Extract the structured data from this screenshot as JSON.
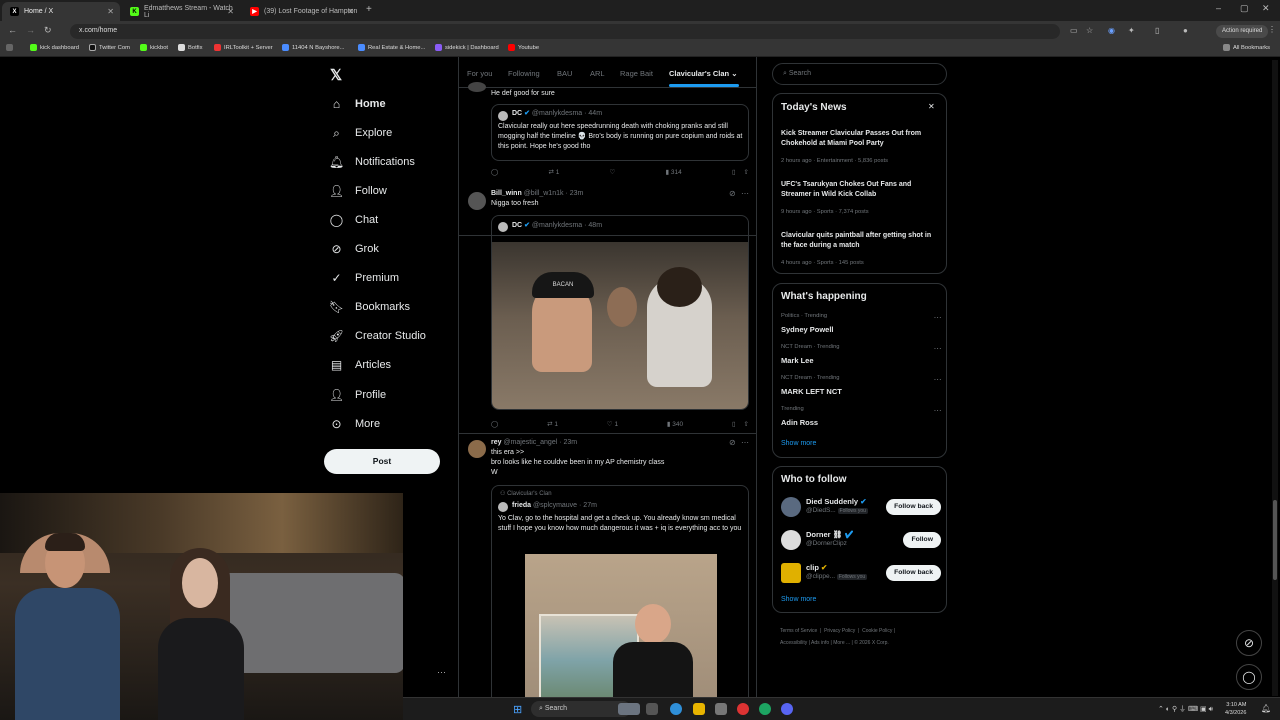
{
  "browser": {
    "tabs": [
      {
        "title": "Home / X",
        "active": true
      },
      {
        "title": "Edmatthews Stream - Watch Li",
        "active": false
      },
      {
        "title": "(39) Lost Footage of Hampton",
        "active": false
      }
    ],
    "url": "x.com/home",
    "action_label": "Action required",
    "bookmarks": [
      "kick dashboard",
      "Twitter Com",
      "kickbot",
      "Botfix",
      "IRLToolkit + Server",
      "11404 N Bayshore...",
      "Real Estate & Home...",
      "sidekick | Dashboard",
      "Youtube"
    ],
    "all_bookmarks": "All Bookmarks"
  },
  "nav": {
    "items": [
      "Home",
      "Explore",
      "Notifications",
      "Follow",
      "Chat",
      "Grok",
      "Premium",
      "Bookmarks",
      "Creator Studio",
      "Articles",
      "Profile",
      "More"
    ],
    "post_label": "Post"
  },
  "timeline": {
    "tabs": [
      "For you",
      "Following",
      "BAU",
      "ARL",
      "Rage Bait",
      "Clavicular's Clan"
    ],
    "post1": {
      "text": "He def good for sure",
      "quote_name": "DC",
      "quote_handle": "@manlykdesma · 44m",
      "quote_text": "Clavicular really out here speedrunning death with choking pranks and still mogging half the timeline 💀 Bro's body is running on pure copium and roids at this point. Hope he's good tho",
      "stats": [
        "",
        "1",
        "",
        "314",
        "",
        ""
      ]
    },
    "post2": {
      "name": "Bill_winn",
      "handle": "@bill_w1n1k · 23m",
      "text": "Nigga too fresh",
      "quote_name": "DC",
      "quote_handle": "@manlykdesma · 48m",
      "hat_text": "BACAN",
      "stats": [
        "",
        "1",
        "1",
        "340",
        "",
        ""
      ]
    },
    "post3": {
      "name": "rey",
      "handle": "@majestic_angel · 23m",
      "lines": [
        "this era >>",
        "bro looks like he couldve been in my AP chemistry class",
        "W"
      ],
      "community": "Clavicular's Clan",
      "quote_name": "frieda",
      "quote_handle": "@splcymauve · 27m",
      "quote_text": "Yo Clav, go to the hospital and get a check up. You already know sm medical stuff I hope you know how much dangerous it was + iq is everything acc to you"
    }
  },
  "sidebar": {
    "search_placeholder": "Search",
    "news_title": "Today's News",
    "news": [
      {
        "title": "Kick Streamer Clavicular Passes Out from Chokehold at Miami Pool Party",
        "meta": "2 hours ago · Entertainment · 5,836 posts"
      },
      {
        "title": "UFC's Tsarukyan Chokes Out Fans and Streamer in Wild Kick Collab",
        "meta": "9 hours ago · Sports · 7,374 posts"
      },
      {
        "title": "Clavicular quits paintball after getting shot in the face during a match",
        "meta": "4 hours ago · Sports · 145 posts"
      }
    ],
    "happening_title": "What's happening",
    "trends": [
      {
        "context": "Politics · Trending",
        "name": "Sydney Powell"
      },
      {
        "context": "NCT Dream · Trending",
        "name": "Mark Lee"
      },
      {
        "context": "NCT Dream · Trending",
        "name": "MARK LEFT NCT"
      },
      {
        "context": "Trending",
        "name": "Adin Ross"
      }
    ],
    "show_more": "Show more",
    "wtf_title": "Who to follow",
    "follow": [
      {
        "name": "Died Suddenly",
        "handle": "@DiedS...",
        "tag": "Follows you",
        "button": "Follow back"
      },
      {
        "name": "Dorner ⛓",
        "handle": "@DornerClipz",
        "tag": "",
        "button": "Follow"
      },
      {
        "name": "clip",
        "handle": "@clippe...",
        "tag": "Follows you",
        "button": "Follow back"
      }
    ],
    "footer": [
      "Terms of Service",
      "Privacy Policy",
      "Cookie Policy",
      "Accessibility",
      "Ads info",
      "More ...",
      "© 2026 X Corp."
    ]
  },
  "taskbar": {
    "search_label": "Search",
    "time": "3:10 AM",
    "date": "4/3/2026"
  }
}
